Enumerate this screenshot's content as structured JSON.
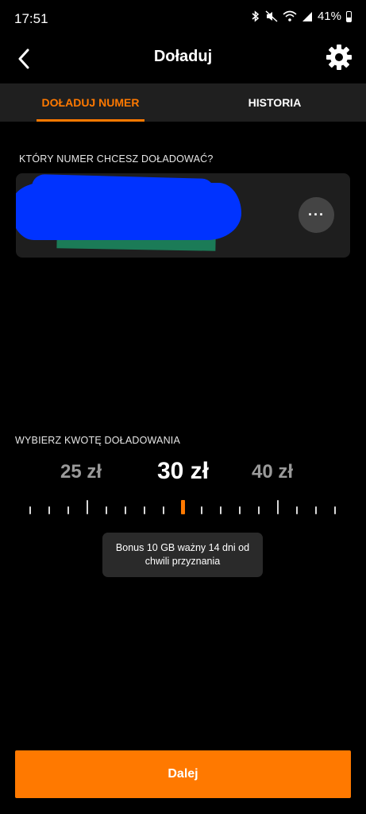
{
  "status_bar": {
    "time": "17:51",
    "battery": "41%",
    "icons": [
      "bluetooth-icon",
      "mute-vibrate-icon",
      "wifi-icon",
      "signal-icon",
      "battery-icon"
    ]
  },
  "header": {
    "title": "Doładuj",
    "back_icon": "chevron-left-icon",
    "settings_icon": "gear-icon"
  },
  "tabs": [
    {
      "label": "DOŁADUJ NUMER",
      "active": true
    },
    {
      "label": "HISTORIA",
      "active": false
    }
  ],
  "number_section": {
    "label": "KTÓRY NUMER CHCESZ DOŁADOWAĆ?",
    "more_button": "···"
  },
  "amount_section": {
    "label": "WYBIERZ KWOTĘ DOŁADOWANIA",
    "options": [
      "25 zł",
      "30 zł",
      "40 zł"
    ],
    "selected": "30 zł",
    "bonus_text": "Bonus 10 GB ważny 14 dni od chwili przyznania"
  },
  "footer": {
    "next_label": "Dalej"
  },
  "colors": {
    "accent": "#ff7900",
    "background": "#000000",
    "surface": "#1e1e1e"
  }
}
